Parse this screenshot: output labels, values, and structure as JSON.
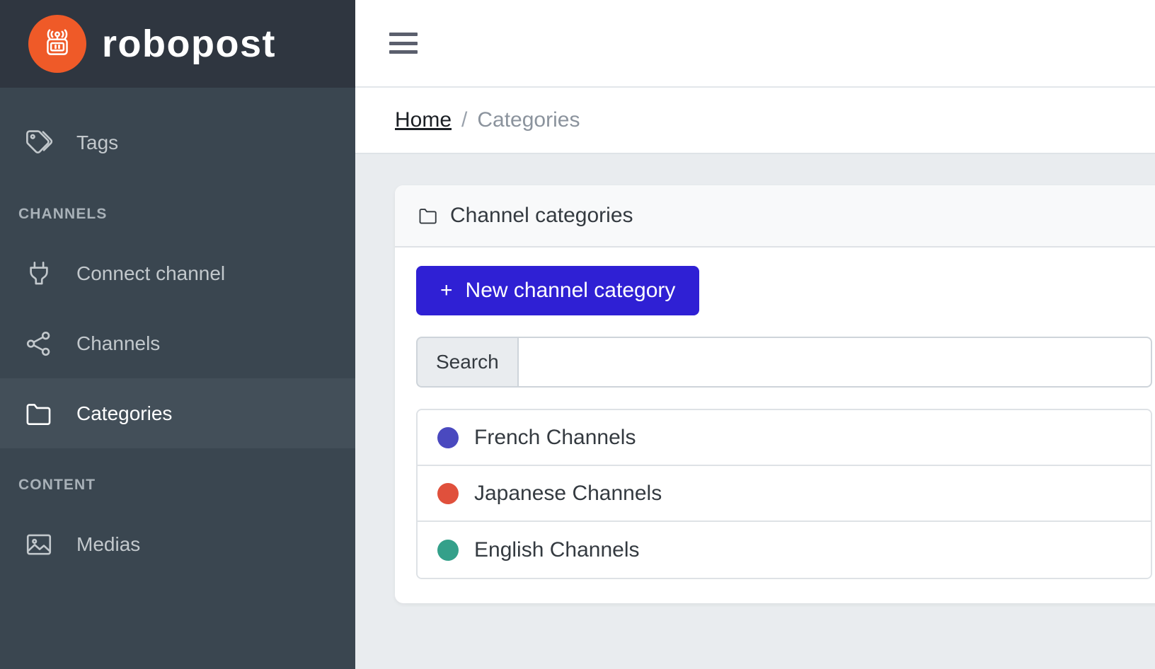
{
  "brand": {
    "name": "robopost",
    "logo_icon": "robot-icon",
    "logo_bg": "#ef5a28"
  },
  "sidebar": {
    "items": [
      {
        "label": "Tags",
        "icon": "tags-icon",
        "active": false
      },
      {
        "label": "Connect channel",
        "icon": "plug-icon",
        "active": false
      },
      {
        "label": "Channels",
        "icon": "share-nodes-icon",
        "active": false
      },
      {
        "label": "Categories",
        "icon": "folder-icon",
        "active": true
      },
      {
        "label": "Medias",
        "icon": "image-icon",
        "active": false
      }
    ],
    "sections": {
      "channels": "CHANNELS",
      "content": "CONTENT"
    },
    "bg": "#3a4650",
    "active_bg": "#434f59"
  },
  "topbar": {
    "menu_icon": "hamburger-menu-icon"
  },
  "breadcrumb": {
    "home": "Home",
    "separator": "/",
    "current": "Categories"
  },
  "card": {
    "header_icon": "folder-icon",
    "header_title": "Channel categories",
    "new_button": {
      "plus": "+",
      "label": "New channel category",
      "color": "#2f20d4"
    },
    "search": {
      "addon_label": "Search",
      "value": "",
      "placeholder": ""
    },
    "categories": [
      {
        "label": "French Channels",
        "color": "#4a49bf"
      },
      {
        "label": "Japanese Channels",
        "color": "#e0503c"
      },
      {
        "label": "English Channels",
        "color": "#34a08a"
      }
    ]
  }
}
